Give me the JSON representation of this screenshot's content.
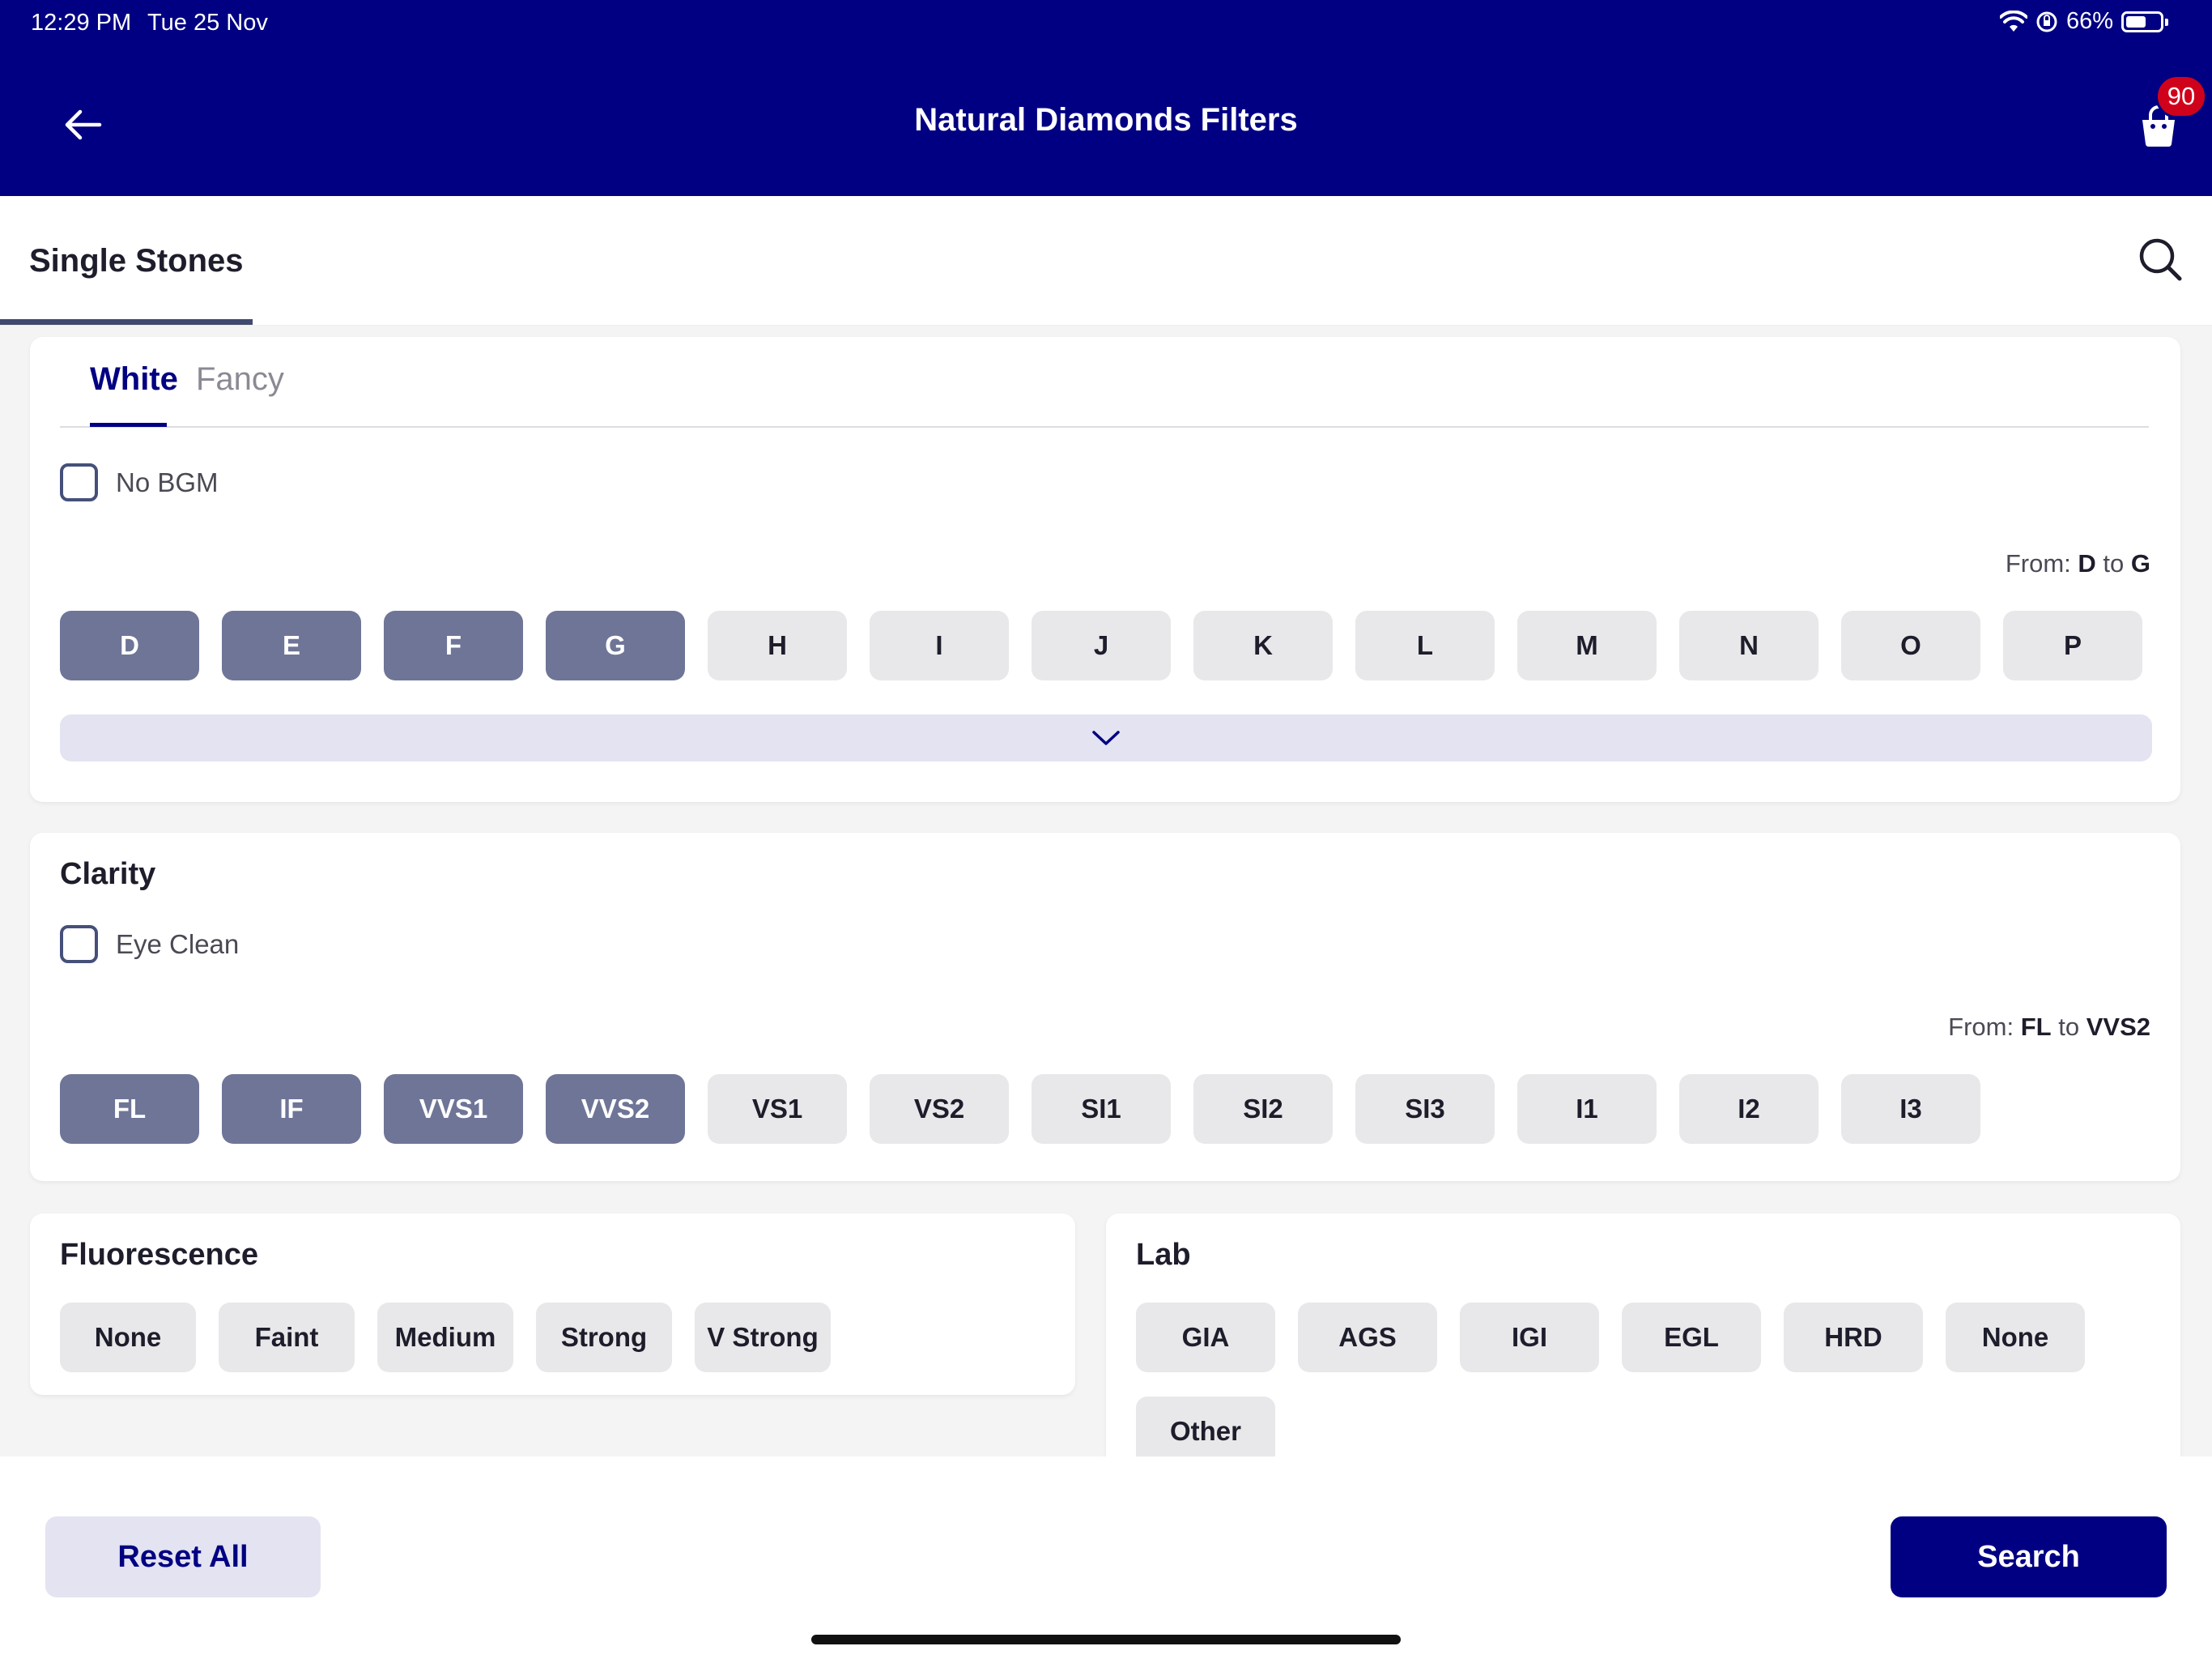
{
  "status": {
    "time": "12:29 PM",
    "date": "Tue 25 Nov",
    "battery": "66%",
    "battery_level": 0.66
  },
  "header": {
    "title": "Natural Diamonds Filters",
    "cart_count": "90"
  },
  "top_tab": {
    "label": "Single Stones"
  },
  "color": {
    "subtabs": {
      "white": "White",
      "fancy": "Fancy"
    },
    "no_bgm_label": "No BGM",
    "range_prefix": "From:",
    "range_from": "D",
    "range_mid": "to",
    "range_to": "G",
    "grades": [
      {
        "label": "D",
        "selected": true
      },
      {
        "label": "E",
        "selected": true
      },
      {
        "label": "F",
        "selected": true
      },
      {
        "label": "G",
        "selected": true
      },
      {
        "label": "H",
        "selected": false
      },
      {
        "label": "I",
        "selected": false
      },
      {
        "label": "J",
        "selected": false
      },
      {
        "label": "K",
        "selected": false
      },
      {
        "label": "L",
        "selected": false
      },
      {
        "label": "M",
        "selected": false
      },
      {
        "label": "N",
        "selected": false
      },
      {
        "label": "O",
        "selected": false
      },
      {
        "label": "P",
        "selected": false
      }
    ]
  },
  "clarity": {
    "title": "Clarity",
    "eye_clean_label": "Eye Clean",
    "range_prefix": "From:",
    "range_from": "FL",
    "range_mid": "to",
    "range_to": "VVS2",
    "grades": [
      {
        "label": "FL",
        "selected": true
      },
      {
        "label": "IF",
        "selected": true
      },
      {
        "label": "VVS1",
        "selected": true
      },
      {
        "label": "VVS2",
        "selected": true
      },
      {
        "label": "VS1",
        "selected": false
      },
      {
        "label": "VS2",
        "selected": false
      },
      {
        "label": "SI1",
        "selected": false
      },
      {
        "label": "SI2",
        "selected": false
      },
      {
        "label": "SI3",
        "selected": false
      },
      {
        "label": "I1",
        "selected": false
      },
      {
        "label": "I2",
        "selected": false
      },
      {
        "label": "I3",
        "selected": false
      }
    ]
  },
  "fluorescence": {
    "title": "Fluorescence",
    "options": [
      "None",
      "Faint",
      "Medium",
      "Strong",
      "V Strong"
    ]
  },
  "lab": {
    "title": "Lab",
    "options": [
      "GIA",
      "AGS",
      "IGI",
      "EGL",
      "HRD",
      "None",
      "Other"
    ]
  },
  "footer": {
    "reset_label": "Reset All",
    "search_label": "Search"
  },
  "colors": {
    "brand": "#010082",
    "selected_chip": "#6f7597",
    "chip": "#e8e8ea",
    "badge": "#d0021b"
  }
}
